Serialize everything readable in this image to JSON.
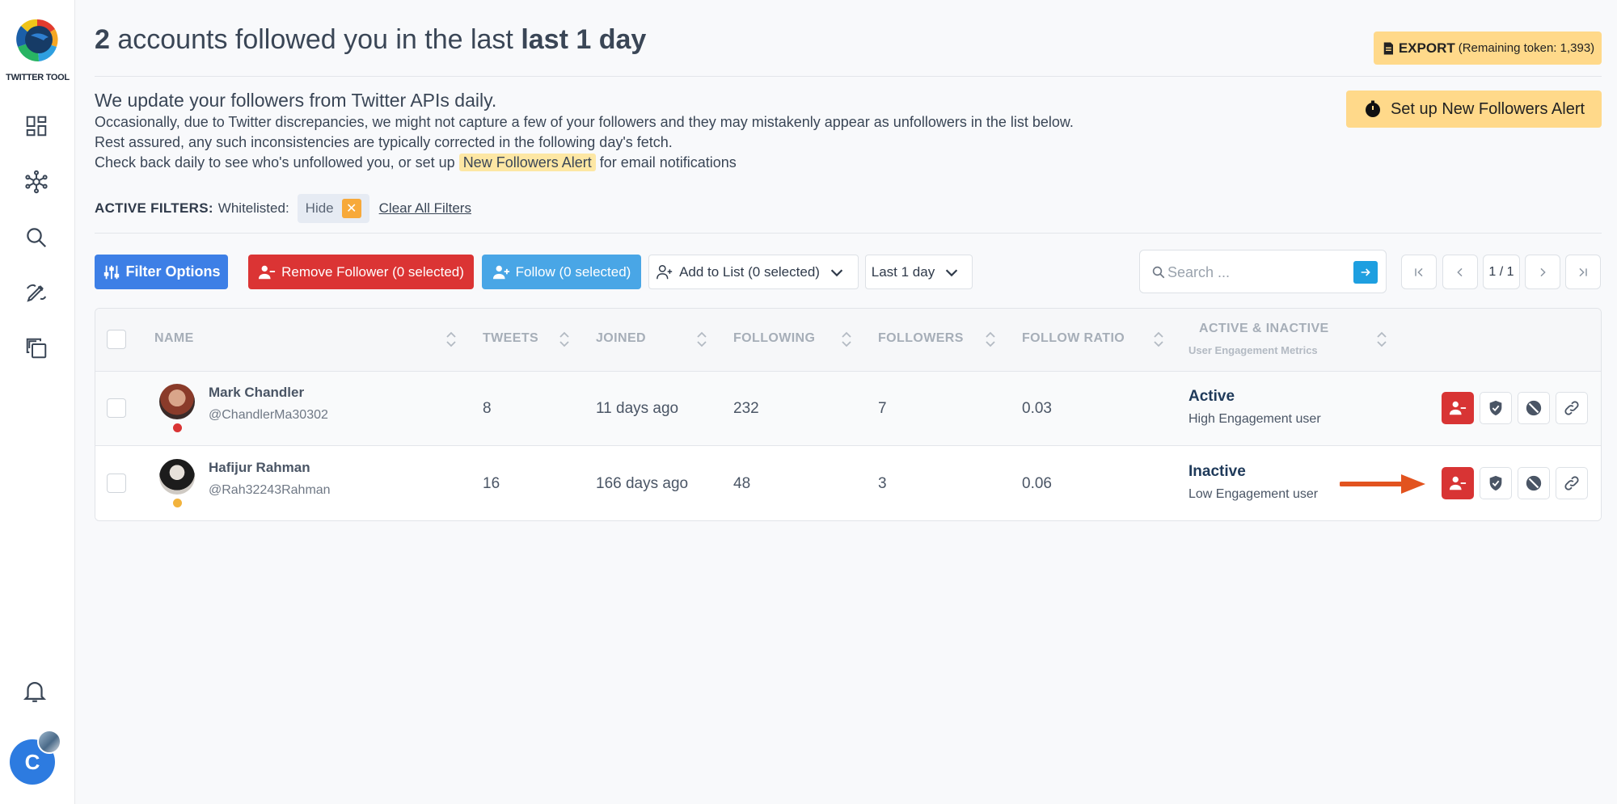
{
  "app": {
    "name": "TWITTER TOOL"
  },
  "header": {
    "count": "2",
    "title_mid": " accounts followed you in the last ",
    "title_range": "last 1 day",
    "export_label": "EXPORT",
    "export_token": "(Remaining token: 1,393)"
  },
  "info": {
    "headline": "We update your followers from Twitter APIs daily.",
    "line1": "Occasionally, due to Twitter discrepancies, we might not capture a few of your followers and they may mistakenly appear as unfollowers in the list below.",
    "line2": "Rest assured, any such inconsistencies are typically corrected in the following day's fetch.",
    "line3_pre": "Check back daily to see who's unfollowed you, or set up ",
    "line3_link": "New Followers Alert",
    "line3_post": " for email notifications",
    "alert_button": "Set up New Followers Alert"
  },
  "filters": {
    "label": "ACTIVE FILTERS:",
    "whitelisted_label": "Whitelisted:",
    "chip_value": "Hide",
    "chip_close": "✕",
    "clear_all": "Clear All Filters"
  },
  "toolbar": {
    "filter_options": "Filter Options",
    "remove_follower": "Remove Follower (0 selected)",
    "follow": "Follow (0 selected)",
    "add_to_list": "Add to List (0 selected)",
    "range": "Last 1 day",
    "search_placeholder": "Search ...",
    "page_indicator": "1 / 1"
  },
  "table": {
    "columns": {
      "name": "NAME",
      "tweets": "TWEETS",
      "joined": "JOINED",
      "following": "FOLLOWING",
      "followers": "FOLLOWERS",
      "follow_ratio": "FOLLOW RATIO",
      "engagement": "ACTIVE & INACTIVE",
      "engagement_sub": "User Engagement Metrics"
    },
    "rows": [
      {
        "name": "Mark Chandler",
        "handle": "@ChandlerMa30302",
        "tweets": "8",
        "joined": "11 days ago",
        "following": "232",
        "followers": "7",
        "ratio": "0.03",
        "status": "Active",
        "status_detail": "High Engagement user",
        "dot_color": "#d93434"
      },
      {
        "name": "Hafijur Rahman",
        "handle": "@Rah32243Rahman",
        "tweets": "16",
        "joined": "166 days ago",
        "following": "48",
        "followers": "3",
        "ratio": "0.06",
        "status": "Inactive",
        "status_detail": "Low Engagement user",
        "dot_color": "#f2b33d"
      }
    ]
  },
  "user": {
    "initial": "C"
  },
  "colors": {
    "primary_blue": "#3d7fe6",
    "danger_red": "#db3434",
    "follow_blue": "#49a6e6",
    "highlight_yellow": "#ffd98a",
    "arrow_orange": "#e2531f"
  },
  "icons": [
    "logo",
    "dashboard-icon",
    "network-icon",
    "search-icon",
    "edit-icon",
    "copy-icon",
    "bell-icon",
    "export-icon",
    "stopwatch-icon",
    "sliders-icon",
    "user-minus-icon",
    "user-plus-icon",
    "list-add-icon",
    "chevron-down-icon",
    "arrow-right-icon",
    "first-page-icon",
    "prev-page-icon",
    "next-page-icon",
    "last-page-icon",
    "sort-icon",
    "shield-icon",
    "block-icon",
    "link-icon",
    "arrow-pointer-icon"
  ]
}
